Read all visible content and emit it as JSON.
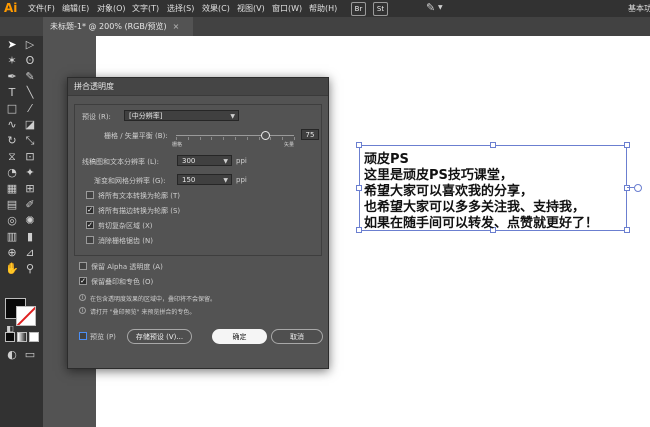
{
  "app": {
    "logo": "Ai",
    "workspace": "基本功"
  },
  "menu": [
    "文件(F)",
    "编辑(E)",
    "对象(O)",
    "文字(T)",
    "选择(S)",
    "效果(C)",
    "视图(V)",
    "窗口(W)",
    "帮助(H)"
  ],
  "badges": [
    "Br",
    "St"
  ],
  "tab": {
    "title": "未标题-1* @ 200% (RGB/预览)",
    "close": "×"
  },
  "canvas_text": {
    "lines": [
      "顽皮PS",
      "这里是顽皮PS技巧课堂，",
      "希望大家可以喜欢我的分享，",
      "也希望大家可以多多关注我、支持我，",
      "如果在随手间可以转发、点赞就更好了！"
    ]
  },
  "dialog": {
    "title": "拼合透明度",
    "preset_label": "预设 (R):",
    "preset_value": "[中分辨率]",
    "slider_label": "栅格 / 矢量平衡 (B):",
    "slider_value": "75",
    "slider_fraction": 0.75,
    "slider_min_label": "栅格",
    "slider_max_label": "矢量",
    "line_res_label": "线稿图和文本分辨率 (L):",
    "line_res_value": "300",
    "gradient_res_label": "渐变和网格分辨率 (G):",
    "gradient_res_value": "150",
    "unit": "ppi",
    "options": [
      {
        "label": "将所有文本转换为轮廓 (T)",
        "checked": false
      },
      {
        "label": "将所有描边转换为轮廓 (S)",
        "checked": true
      },
      {
        "label": "剪切复杂区域 (X)",
        "checked": true
      },
      {
        "label": "消除栅格锯齿 (N)",
        "checked": false
      }
    ],
    "preserve_alpha": {
      "label": "保留 Alpha 透明度 (A)",
      "checked": false
    },
    "preserve_overprint": {
      "label": "保留叠印和专色 (O)",
      "checked": true
    },
    "info1": "在包含透明度效果的区域中，叠印将不会保留。",
    "info2": "请打开 \"叠印预览\" 来预览拼合的专色。",
    "preview_label": "预览 (P)",
    "save_preset_label": "存储预设 (V)...",
    "ok_label": "确定",
    "cancel_label": "取消"
  },
  "colors": {
    "accent": "#6b7fd0",
    "logo": "#ff9a00",
    "stroke_slash": "#e02020"
  }
}
